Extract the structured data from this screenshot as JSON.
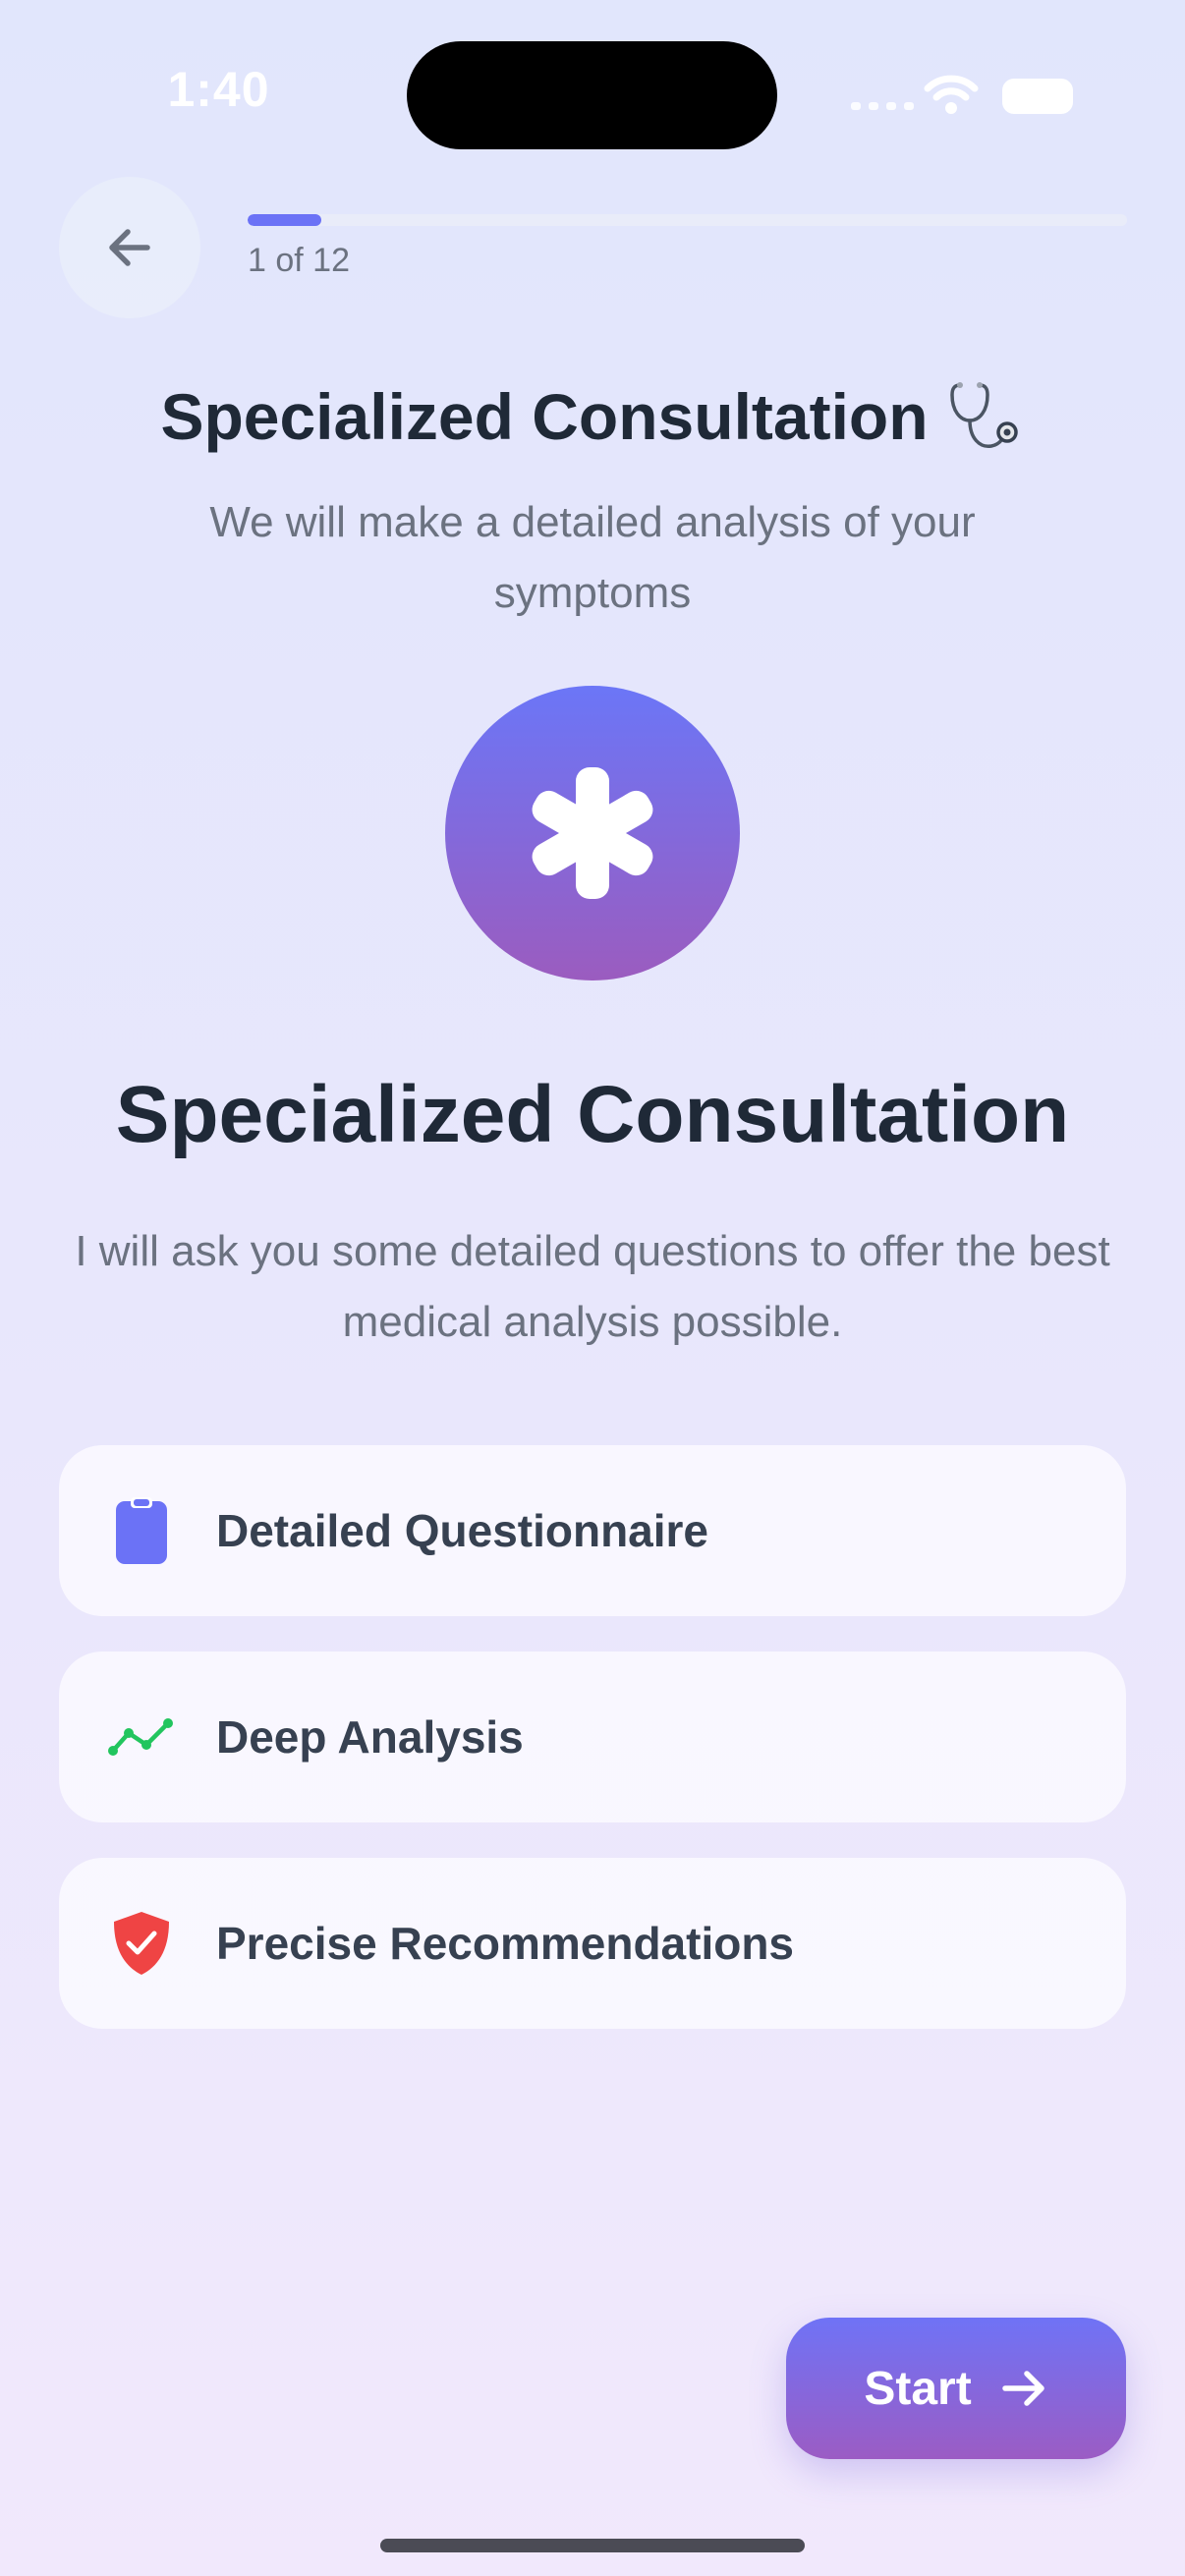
{
  "status_bar": {
    "time": "1:40"
  },
  "header": {
    "back_icon": "arrow-left-icon",
    "progress": {
      "current": 1,
      "total": 12,
      "label": "1 of 12"
    }
  },
  "intro": {
    "title": "Specialized Consultation",
    "title_icon": "stethoscope-icon",
    "subtitle": "We will make a detailed analysis of your symptoms"
  },
  "hero": {
    "icon": "medical-asterisk-icon",
    "title": "Specialized Consultation",
    "description": "I will ask you some detailed questions to offer the best medical analysis possible."
  },
  "features": [
    {
      "icon": "clipboard-icon",
      "label": "Detailed Questionnaire",
      "color": "#6b72f6"
    },
    {
      "icon": "trend-line-icon",
      "label": "Deep Analysis",
      "color": "#22c55e"
    },
    {
      "icon": "shield-check-icon",
      "label": "Precise Recommendations",
      "color": "#ef4444"
    }
  ],
  "actions": {
    "start_label": "Start",
    "start_icon": "arrow-right-icon"
  },
  "colors": {
    "accent": "#6b72f6",
    "accent_end": "#9b5cbf",
    "heading": "#1f2937",
    "muted": "#6b7280"
  }
}
